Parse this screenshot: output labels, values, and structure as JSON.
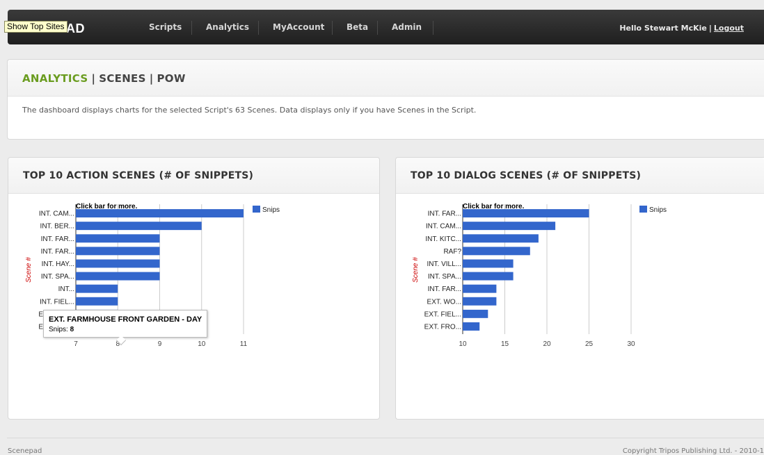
{
  "nav": {
    "logo_partial": "AD",
    "items": [
      "Scripts",
      "Analytics",
      "MyAccount",
      "Beta",
      "Admin"
    ],
    "greeting": "Hello Stewart McKie",
    "separator": "|",
    "logout": "Logout"
  },
  "tooltip_topsites": "Show Top Sites",
  "breadcrumb": {
    "active": "ANALYTICS",
    "sep": "|",
    "items": [
      "SCENES",
      "POW"
    ]
  },
  "description": "The dashboard displays charts for the selected Script's 63 Scenes. Data displays only if you have Scenes in the Script.",
  "panels": {
    "action_title": "TOP 10 ACTION SCENES (# OF SNIPPETS)",
    "dialog_title": "TOP 10 DIALOG SCENES (# OF SNIPPETS)"
  },
  "bar_tooltip": {
    "title": "EXT. FARMHOUSE FRONT GARDEN - DAY",
    "label": "Snips: ",
    "value": "8"
  },
  "colors": {
    "bar": "#3366cc",
    "accent": "#6a9c1f",
    "ylabel": "#cc0000"
  },
  "chart_data": [
    {
      "type": "bar",
      "orientation": "horizontal",
      "title": "Click bar for more.",
      "ylabel": "Scene #",
      "categories": [
        "INT. CAM...",
        "INT. BER...",
        "INT. FAR...",
        "INT. FAR...",
        "INT. HAY...",
        "INT. SPA...",
        "INT...",
        "INT. FIEL...",
        "EXT. FAR...",
        "EXT. FAR..."
      ],
      "series": [
        {
          "name": "Snips",
          "values": [
            11,
            10,
            9,
            9,
            9,
            9,
            8,
            8,
            8,
            8
          ]
        }
      ],
      "xlim": [
        7,
        11
      ],
      "xticks": [
        "7",
        "8",
        "9",
        "10",
        "11"
      ],
      "legend": "right",
      "grid": true
    },
    {
      "type": "bar",
      "orientation": "horizontal",
      "title": "Click bar for more.",
      "ylabel": "Scene #",
      "categories": [
        "INT. FAR...",
        "INT. CAM...",
        "INT. KITC...",
        "RAF?",
        "INT. VILL...",
        "INT. SPA...",
        "INT. FAR...",
        "EXT. WO...",
        "EXT. FIEL...",
        "EXT. FRO..."
      ],
      "series": [
        {
          "name": "Snips",
          "values": [
            25,
            21,
            19,
            18,
            16,
            16,
            14,
            14,
            13,
            12
          ]
        }
      ],
      "xlim": [
        10,
        30
      ],
      "xticks": [
        "10",
        "15",
        "20",
        "25",
        "30"
      ],
      "legend": "right",
      "grid": true
    }
  ],
  "footer": {
    "left": "Scenepad",
    "right": "Copyright Tripos Publishing Ltd. - 2010-1"
  }
}
